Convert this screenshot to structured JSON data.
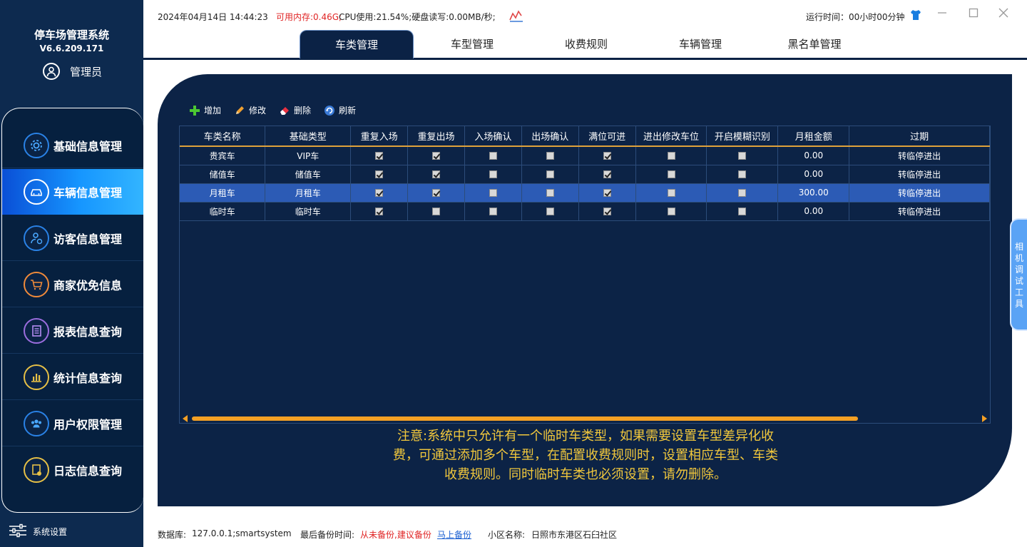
{
  "app": {
    "title": "停车场管理系统",
    "version": "V6.6.209.171",
    "user": "管理员"
  },
  "sidebar": {
    "items": [
      {
        "label": "基础信息管理",
        "icon": "gear-icon"
      },
      {
        "label": "车辆信息管理",
        "icon": "car-icon"
      },
      {
        "label": "访客信息管理",
        "icon": "visitor-icon"
      },
      {
        "label": "商家优免信息",
        "icon": "cart-icon"
      },
      {
        "label": "报表信息查询",
        "icon": "report-icon"
      },
      {
        "label": "统计信息查询",
        "icon": "bar-chart-icon"
      },
      {
        "label": "用户权限管理",
        "icon": "users-icon"
      },
      {
        "label": "日志信息查询",
        "icon": "log-icon"
      }
    ],
    "settings_label": "系统设置"
  },
  "topbar": {
    "datetime": "2024年04月14日 14:44:23",
    "memory": "可用内存:0.46G;",
    "cpu_disk": "CPU使用:21.54%;硬盘读写:0.00MB/秒;",
    "runtime": "运行时间：00小时00分钟"
  },
  "tabs": [
    "车类管理",
    "车型管理",
    "收费规则",
    "车辆管理",
    "黑名单管理"
  ],
  "toolbar": {
    "add": "增加",
    "edit": "修改",
    "delete": "删除",
    "refresh": "刷新"
  },
  "table": {
    "columns": [
      "车类名称",
      "基础类型",
      "重复入场",
      "重复出场",
      "入场确认",
      "出场确认",
      "满位可进",
      "进出修改车位",
      "开启模糊识别",
      "月租金额",
      "过期"
    ],
    "rows": [
      {
        "name": "贵宾车",
        "type": "VIP车",
        "checks": [
          true,
          true,
          false,
          false,
          true,
          false,
          false
        ],
        "amount": "0.00",
        "expire": "转临停进出"
      },
      {
        "name": "储值车",
        "type": "储值车",
        "checks": [
          true,
          true,
          false,
          false,
          true,
          false,
          false
        ],
        "amount": "0.00",
        "expire": "转临停进出"
      },
      {
        "name": "月租车",
        "type": "月租车",
        "checks": [
          true,
          true,
          false,
          false,
          true,
          false,
          false
        ],
        "amount": "300.00",
        "expire": "转临停进出"
      },
      {
        "name": "临时车",
        "type": "临时车",
        "checks": [
          true,
          false,
          false,
          false,
          true,
          false,
          false
        ],
        "amount": "0.00",
        "expire": "转临停进出"
      }
    ],
    "selected_row": 2
  },
  "notice": {
    "line1": "注意:系统中只允许有一个临时车类型，如果需要设置车型差异化收",
    "line2": "费，可通过添加多个车型，在配置收费规则时，设置相应车型、车类",
    "line3": "收费规则。同时临时车类也必须设置，请勿删除。"
  },
  "side_tool": "相机调试工具",
  "statusbar": {
    "db_label": "数据库:",
    "db_value": "127.0.0.1;smartsystem",
    "backup_label": "最后备份时间:",
    "backup_value": "从未备份,建议备份",
    "backup_link": "马上备份",
    "community_label": "小区名称:",
    "community_value": "日照市东港区石臼社区"
  },
  "colors": {
    "sidebar_bg": "#0d2a4f",
    "panel_bg": "#0c2346",
    "accent_active": "#1696ff",
    "header_underline": "#e0a23a",
    "notice_text": "#f2c83c",
    "warning_red": "#e02424"
  }
}
